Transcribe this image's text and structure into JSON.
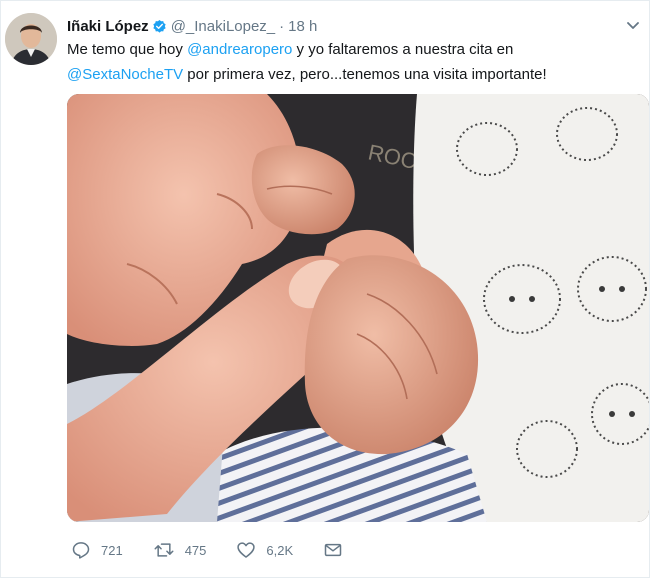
{
  "tweet": {
    "author_name": "Iñaki López",
    "handle": "@_InakiLopez_",
    "separator": "·",
    "time": "18 h",
    "text_part1": "Me temo que hoy ",
    "mention1": "@andrearopero",
    "text_part2": " y yo faltaremos a nuestra cita en",
    "mention2": "@SextaNocheTV",
    "text_part3": " por primera vez, pero...tenemos una visita importante!"
  },
  "actions": {
    "reply_count": "721",
    "retweet_count": "475",
    "like_count": "6,2K"
  },
  "colors": {
    "link": "#1da1f2",
    "verified": "#1da1f2",
    "muted": "#657786"
  },
  "icons": [
    "verified-badge-icon",
    "chevron-down-icon",
    "reply-icon",
    "retweet-icon",
    "like-icon",
    "message-icon"
  ]
}
